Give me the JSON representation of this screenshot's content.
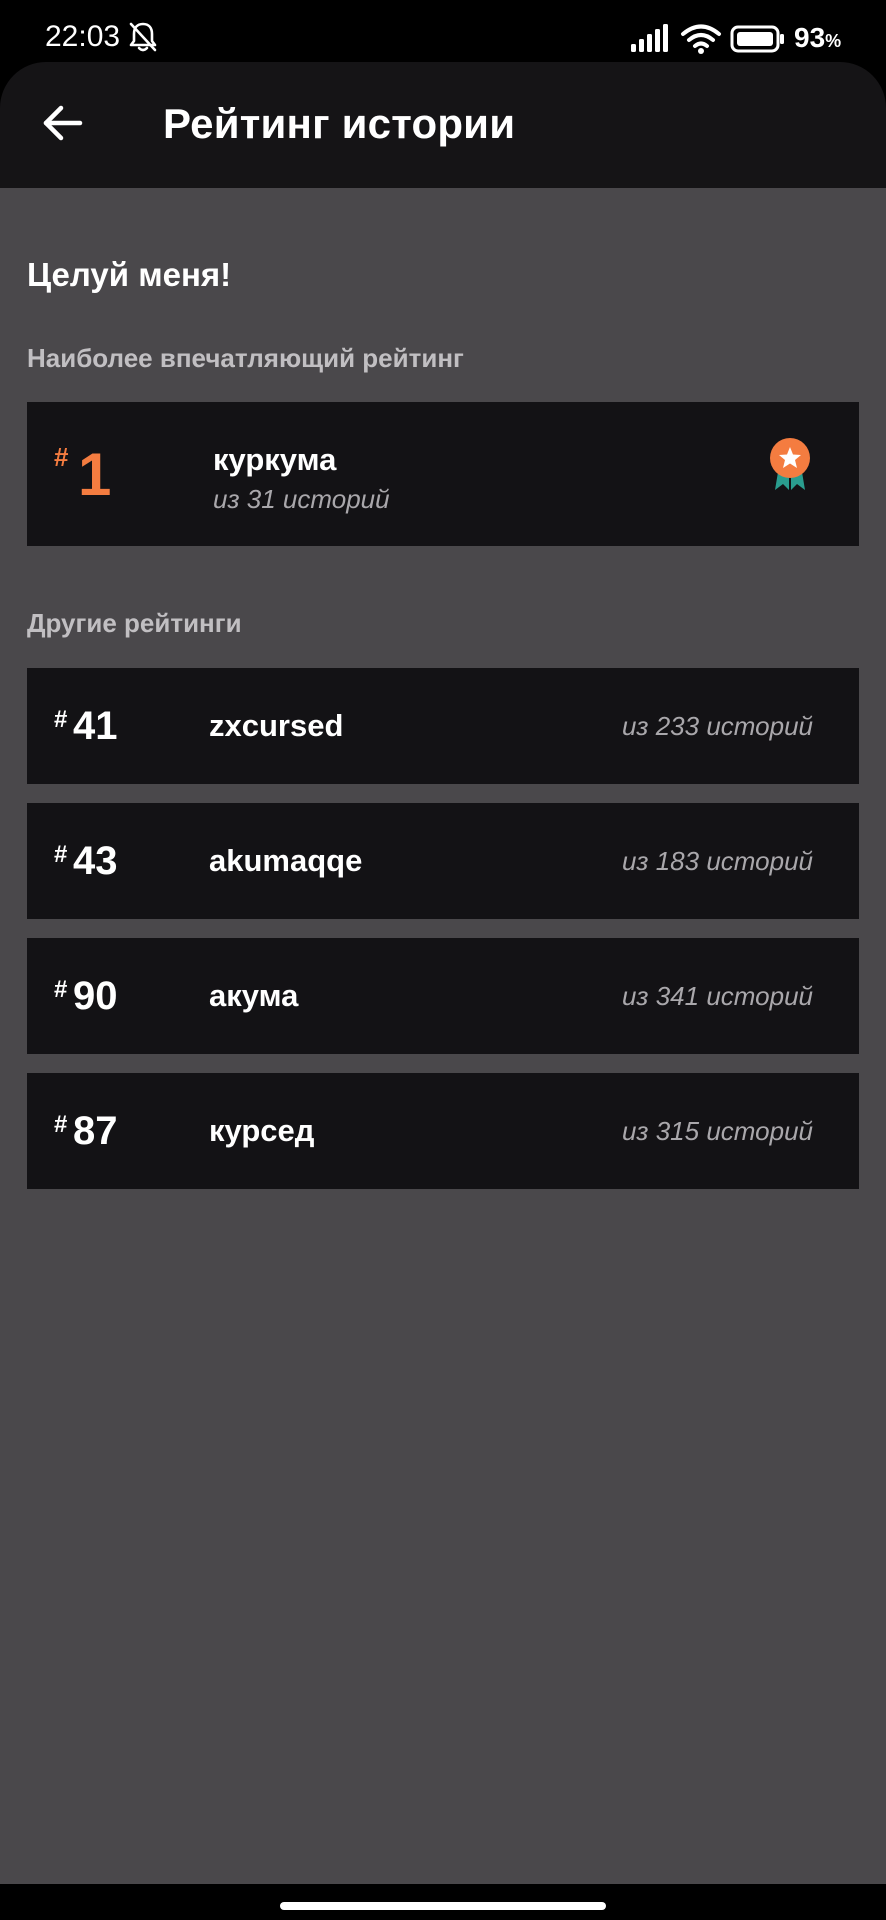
{
  "status_bar": {
    "time": "22:03",
    "battery": "93",
    "battery_unit": "%",
    "icons": [
      "bell-off-icon",
      "signal-icon",
      "wifi-icon",
      "battery-icon"
    ]
  },
  "header": {
    "title": "Рейтинг истории",
    "back_icon": "arrow-left-icon"
  },
  "story": {
    "title": "Целуй меня!"
  },
  "best_rating": {
    "label": "Наиболее впечатляющий рейтинг",
    "hash": "#",
    "rank": "1",
    "name": "куркума",
    "subtitle": "из 31 историй",
    "icon": "medal-icon"
  },
  "other_ratings": {
    "label": "Другие рейтинги",
    "items": [
      {
        "hash": "#",
        "rank": "41",
        "name": "zxcursed",
        "count": "из 233 историй"
      },
      {
        "hash": "#",
        "rank": "43",
        "name": "akumaqqe",
        "count": "из 183 историй"
      },
      {
        "hash": "#",
        "rank": "90",
        "name": "акума",
        "count": "из 341 историй"
      },
      {
        "hash": "#",
        "rank": "87",
        "name": "курсед",
        "count": "из 315 историй"
      }
    ]
  },
  "colors": {
    "accent": "#f47c40",
    "card_bg": "#131215",
    "content_bg": "#4a484b",
    "header_bg": "#151416",
    "muted_text": "#a9a7ab",
    "medal_ribbon": "#2a9d8f"
  }
}
